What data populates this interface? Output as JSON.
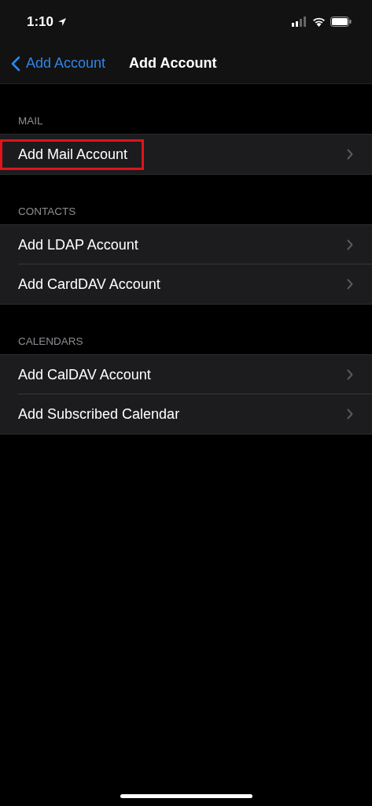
{
  "status_bar": {
    "time": "1:10"
  },
  "nav_bar": {
    "back": "Add Account",
    "title": "Add Account"
  },
  "sections": [
    {
      "header": "MAIL",
      "items": [
        {
          "label": "Add Mail Account",
          "highlighted": true
        }
      ]
    },
    {
      "header": "CONTACTS",
      "items": [
        {
          "label": "Add LDAP Account",
          "highlighted": false
        },
        {
          "label": "Add CardDAV Account",
          "highlighted": false
        }
      ]
    },
    {
      "header": "CALENDARS",
      "items": [
        {
          "label": "Add CalDAV Account",
          "highlighted": false
        },
        {
          "label": "Add Subscribed Calendar",
          "highlighted": false
        }
      ]
    }
  ]
}
